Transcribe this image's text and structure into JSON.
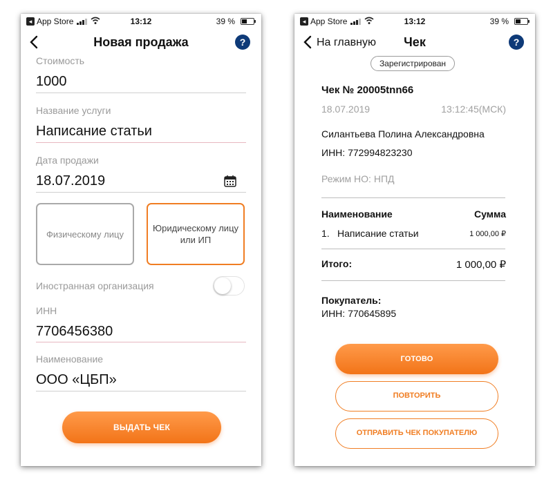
{
  "status_bar": {
    "app_label": "App Store",
    "time": "13:12",
    "battery": "39 %"
  },
  "left_screen": {
    "title": "Новая продажа",
    "help_label": "?",
    "fields": {
      "cost_label": "Стоимость",
      "cost_value": "1000",
      "service_label": "Название услуги",
      "service_value": "Написание статьи",
      "date_label": "Дата продажи",
      "date_value": "18.07.2019",
      "inn_label": "ИНН",
      "inn_value": "7706456380",
      "name_label": "Наименование",
      "name_value": "ООО «ЦБП»"
    },
    "client_types": {
      "individual": "Физическому лицу",
      "legal": "Юридическому лицу или ИП",
      "selected": "legal"
    },
    "foreign_org_label": "Иностранная организация",
    "foreign_org_enabled": false,
    "issue_button": "ВЫДАТЬ ЧЕК"
  },
  "right_screen": {
    "back_label": "На главную",
    "title": "Чек",
    "help_label": "?",
    "status_badge": "Зарегистрирован",
    "receipt_number": "Чек № 20005tnn66",
    "date": "18.07.2019",
    "time": "13:12:45(МСК)",
    "seller_name": "Силантьева Полина Александровна",
    "seller_inn": "ИНН: 772994823230",
    "tax_mode": "Режим НО: НПД",
    "table": {
      "header_name": "Наименование",
      "header_sum": "Сумма",
      "rows": [
        {
          "index": "1.",
          "name": "Написание статьи",
          "sum": "1 000,00 ₽"
        }
      ],
      "total_label": "Итого:",
      "total_value": "1 000,00 ₽"
    },
    "buyer_label": "Покупатель:",
    "buyer_inn": "ИНН: 770645895",
    "buttons": {
      "done": "ГОТОВО",
      "repeat": "ПОВТОРИТЬ",
      "send": "ОТПРАВИТЬ ЧЕК ПОКУПАТЕЛЮ"
    }
  },
  "colors": {
    "accent_orange": "#f07d22",
    "help_blue": "#0e3a78"
  }
}
